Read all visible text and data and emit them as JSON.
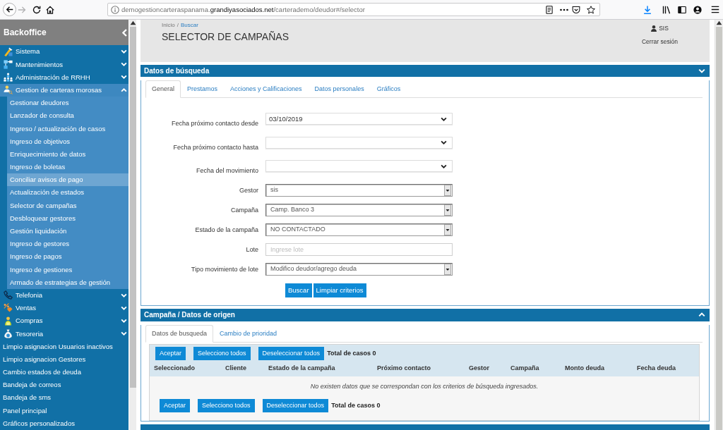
{
  "browser": {
    "url": "demogestioncarteraspanama.**grandiyasociados.net**/carterademo/deudor#/selector"
  },
  "sidebar": {
    "title": "Backoffice",
    "items": [
      {
        "kind": "group",
        "label": "Sistema",
        "expanded": false,
        "selected": false
      },
      {
        "kind": "group",
        "label": "Mantenimientos",
        "expanded": false,
        "selected": false
      },
      {
        "kind": "group",
        "label": "Administración de RRHH",
        "expanded": false,
        "selected": false
      },
      {
        "kind": "group",
        "label": "Gestion de carteras morosas",
        "expanded": true,
        "selected": false,
        "children": [
          {
            "label": "Gestionar deudores",
            "selected": false
          },
          {
            "label": "Lanzador de consulta",
            "selected": false
          },
          {
            "label": "Ingreso / actualización de casos",
            "selected": false
          },
          {
            "label": "Ingreso de objetivos",
            "selected": false
          },
          {
            "label": "Enriquecimiento de datos",
            "selected": false
          },
          {
            "label": "Ingreso de boletas",
            "selected": false
          },
          {
            "label": "Conciliar avisos de pago",
            "selected": true
          },
          {
            "label": "Actualización de estados",
            "selected": false
          },
          {
            "label": "Selector de campañas",
            "selected": false
          },
          {
            "label": "Desbloquear gestores",
            "selected": false
          },
          {
            "label": "Gestión liquidación",
            "selected": false
          },
          {
            "label": "Ingreso de gestores",
            "selected": false
          },
          {
            "label": "Ingreso de pagos",
            "selected": false
          },
          {
            "label": "Ingreso de gestiones",
            "selected": false
          },
          {
            "label": "Armado de estrategias de gestión",
            "selected": false
          }
        ]
      },
      {
        "kind": "group",
        "label": "Telefonia",
        "expanded": false,
        "selected": false
      },
      {
        "kind": "group",
        "label": "Ventas",
        "expanded": false,
        "selected": false
      },
      {
        "kind": "group",
        "label": "Compras",
        "expanded": false,
        "selected": false
      },
      {
        "kind": "group",
        "label": "Tesoreria",
        "expanded": false,
        "selected": false
      },
      {
        "kind": "link",
        "label": "Limpio asignacion Usuarios inactivos",
        "selected": false
      },
      {
        "kind": "link",
        "label": "Limpio asignacion Gestores",
        "selected": false
      },
      {
        "kind": "link",
        "label": "Cambio estados de deuda",
        "selected": false
      },
      {
        "kind": "link",
        "label": "Bandeja de correos",
        "selected": false
      },
      {
        "kind": "link",
        "label": "Bandeja de sms",
        "selected": false
      },
      {
        "kind": "link",
        "label": "Panel principal",
        "selected": false
      },
      {
        "kind": "link",
        "label": "Gráficos personalizados",
        "selected": false
      }
    ]
  },
  "header": {
    "breadcrumb": [
      "Inicio",
      "Buscar"
    ],
    "separator": "/",
    "title": "SELECTOR DE CAMPAÑAS",
    "user": "SIS",
    "logout": "Cerrar sesión"
  },
  "panels": [
    {
      "kind": "form",
      "title": "Datos de búsqueda",
      "tabs": [
        {
          "label": "General",
          "selected": true
        },
        {
          "label": "Prestamos",
          "selected": false
        },
        {
          "label": "Acciones y Calificaciones",
          "selected": false
        },
        {
          "label": "Datos personales",
          "selected": false
        },
        {
          "label": "Gráficos",
          "selected": false
        }
      ],
      "fields": [
        {
          "kind": "date",
          "label": "Fecha próximo contacto desde",
          "value": "03/10/2019"
        },
        {
          "kind": "date",
          "label": "Fecha próximo contacto hasta"
        },
        {
          "kind": "date",
          "label": "Fecha del movimiento"
        },
        {
          "kind": "select",
          "label": "Gestor",
          "value": "sis"
        },
        {
          "kind": "select",
          "label": "Campaña",
          "value": "Camp. Banco 3"
        },
        {
          "kind": "select",
          "label": "Estado de la campaña",
          "value": "NO CONTACTADO"
        },
        {
          "kind": "text",
          "label": "Lote",
          "placeholder": "Ingrese lote"
        },
        {
          "kind": "select",
          "label": "Tipo movimiento de lote",
          "value": "Modifico deudor/agrego deuda"
        }
      ],
      "buttons": [
        "Buscar",
        "Limpiar criterios"
      ]
    },
    {
      "kind": "results",
      "title": "Campaña / Datos de origen",
      "tabs": [
        {
          "label": "Datos de busqueda",
          "selected": true
        },
        {
          "label": "Cambio de prioridad",
          "selected": false
        }
      ],
      "top_actions": {
        "buttons": [
          "Aceptar",
          "Selecciono todos",
          "Deseleccionar todos"
        ],
        "total": "Total de casos 0"
      },
      "table": {
        "columns": [
          "Seleccionado",
          "Cliente",
          "Estado de la campaña",
          "Próximo contacto",
          "Gestor",
          "Campaña",
          "Monto deuda",
          "Fecha deuda"
        ],
        "empty_message": "No existen datos que se correspondan con los criterios de búsqueda ingresados."
      },
      "bottom_actions": {
        "buttons": [
          "Aceptar",
          "Selecciono todos",
          "Deseleccionar todos"
        ],
        "total": "Total de casos 0"
      }
    },
    {
      "kind": "bar"
    }
  ]
}
